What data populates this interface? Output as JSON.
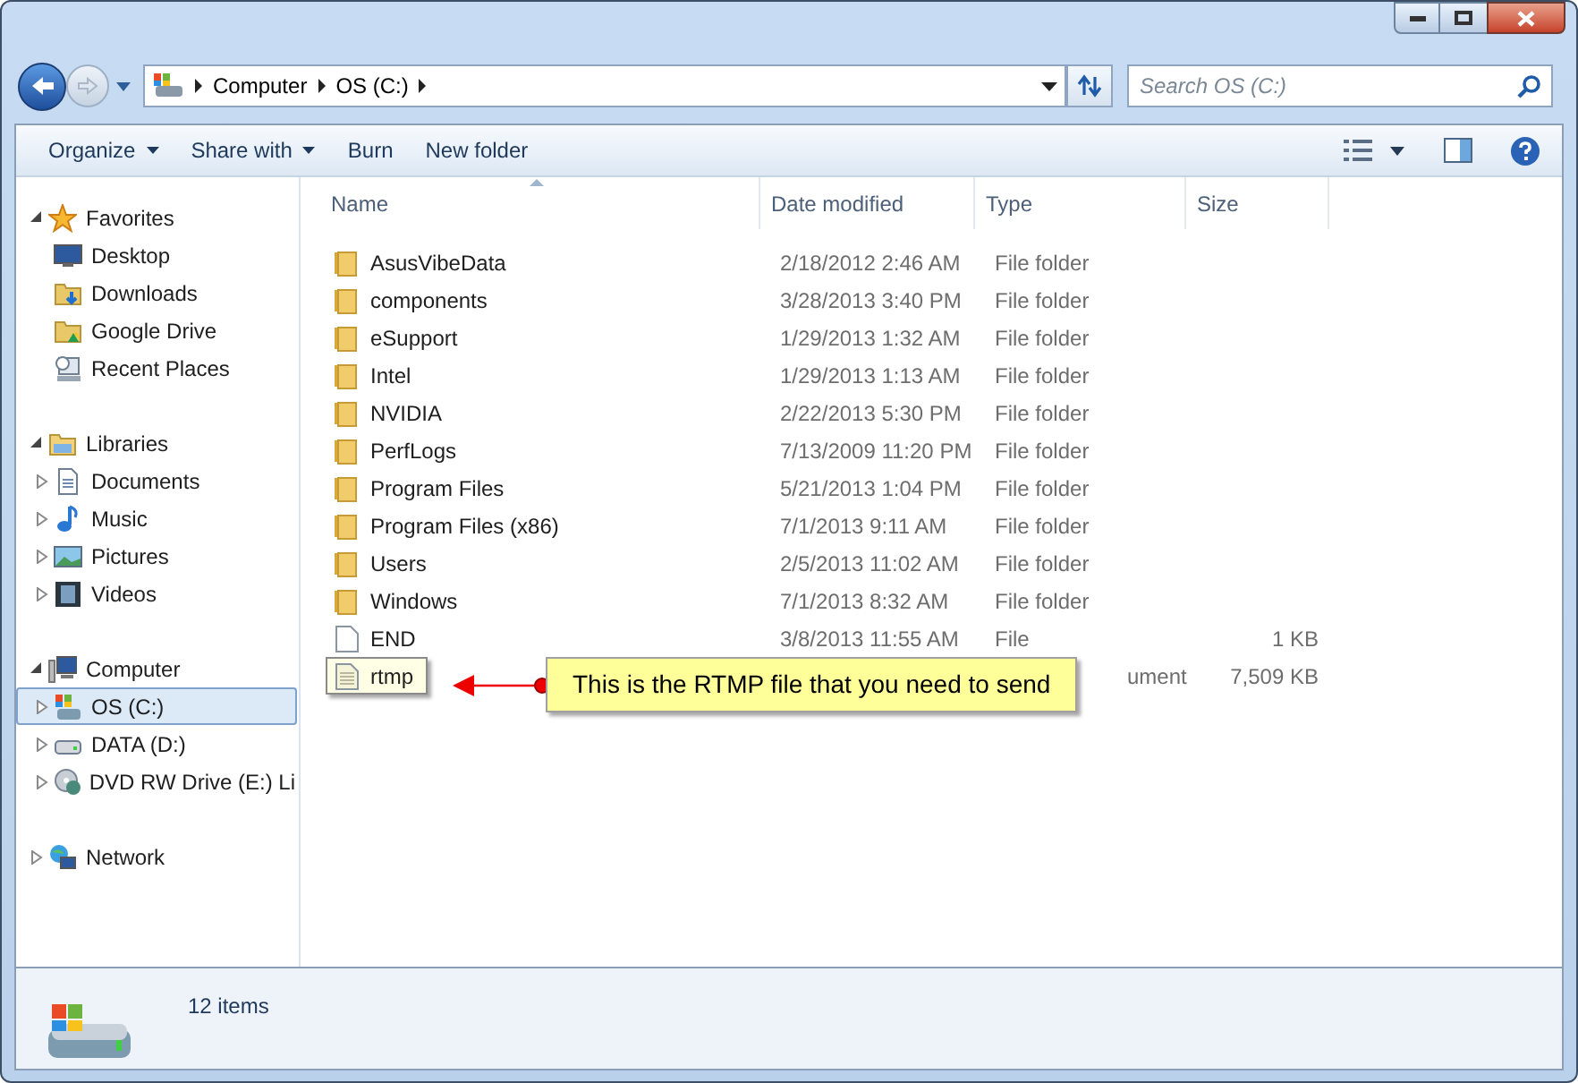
{
  "address": {
    "crumbs": [
      "Computer",
      "OS (C:)"
    ]
  },
  "search": {
    "placeholder": "Search OS (C:)"
  },
  "toolbar": {
    "buttons": [
      {
        "label": "Organize",
        "dropdown": true
      },
      {
        "label": "Share with",
        "dropdown": true
      },
      {
        "label": "Burn",
        "dropdown": false
      },
      {
        "label": "New folder",
        "dropdown": false
      }
    ]
  },
  "sidebar": {
    "groups": [
      {
        "label": "Favorites",
        "kind": "star",
        "expanded": true,
        "selected": false,
        "children": [
          {
            "label": "Desktop",
            "kind": "monitor",
            "selected": false
          },
          {
            "label": "Downloads",
            "kind": "downloads",
            "selected": false
          },
          {
            "label": "Google Drive",
            "kind": "gdrive",
            "selected": false
          },
          {
            "label": "Recent Places",
            "kind": "recent",
            "selected": false
          }
        ]
      },
      {
        "label": "Libraries",
        "kind": "library",
        "expanded": true,
        "selected": false,
        "children": [
          {
            "label": "Documents",
            "kind": "document",
            "expanded": false,
            "selected": false
          },
          {
            "label": "Music",
            "kind": "music",
            "expanded": false,
            "selected": false
          },
          {
            "label": "Pictures",
            "kind": "picture",
            "expanded": false,
            "selected": false
          },
          {
            "label": "Videos",
            "kind": "film",
            "expanded": false,
            "selected": false
          }
        ]
      },
      {
        "label": "Computer",
        "kind": "computer",
        "expanded": true,
        "selected": false,
        "children": [
          {
            "label": "OS (C:)",
            "kind": "windrive",
            "expanded": false,
            "selected": true
          },
          {
            "label": "DATA (D:)",
            "kind": "drive",
            "expanded": false,
            "selected": false
          },
          {
            "label": "DVD RW Drive (E:) Li",
            "kind": "disc",
            "expanded": false,
            "selected": false
          }
        ]
      },
      {
        "label": "Network",
        "kind": "globe",
        "expanded": false,
        "selected": false
      }
    ]
  },
  "table": {
    "columns": [
      {
        "label": "Name",
        "sorted": true
      },
      {
        "label": "Date modified",
        "sorted": false
      },
      {
        "label": "Type",
        "sorted": false
      },
      {
        "label": "Size",
        "sorted": false
      }
    ],
    "rows": [
      {
        "kind": "folder",
        "name": "AsusVibeData",
        "date": "2/18/2012 2:46 AM",
        "type": "File folder",
        "selected": false
      },
      {
        "kind": "folder",
        "name": "components",
        "date": "3/28/2013 3:40 PM",
        "type": "File folder",
        "selected": false
      },
      {
        "kind": "folder",
        "name": "eSupport",
        "date": "1/29/2013 1:32 AM",
        "type": "File folder",
        "selected": false
      },
      {
        "kind": "folder",
        "name": "Intel",
        "date": "1/29/2013 1:13 AM",
        "type": "File folder",
        "selected": false
      },
      {
        "kind": "folder",
        "name": "NVIDIA",
        "date": "2/22/2013 5:30 PM",
        "type": "File folder",
        "selected": false
      },
      {
        "kind": "folder",
        "name": "PerfLogs",
        "date": "7/13/2009 11:20 PM",
        "type": "File folder",
        "selected": false
      },
      {
        "kind": "folder",
        "name": "Program Files",
        "date": "5/21/2013 1:04 PM",
        "type": "File folder",
        "selected": false
      },
      {
        "kind": "folder",
        "name": "Program Files (x86)",
        "date": "7/1/2013 9:11 AM",
        "type": "File folder",
        "selected": false
      },
      {
        "kind": "folder",
        "name": "Users",
        "date": "2/5/2013 11:02 AM",
        "type": "File folder",
        "selected": false
      },
      {
        "kind": "folder",
        "name": "Windows",
        "date": "7/1/2013 8:32 AM",
        "type": "File folder",
        "selected": false
      },
      {
        "kind": "file",
        "name": "END",
        "date": "3/8/2013 11:55 AM",
        "type": "File",
        "size": "1 KB",
        "selected": false
      },
      {
        "kind": "textfile",
        "name": "rtmp",
        "type": "ument",
        "size": "7,509 KB",
        "selected": true
      }
    ]
  },
  "callout": {
    "text": "This is the RTMP file that you need to send"
  },
  "status_bar": {
    "text": "12 items"
  }
}
